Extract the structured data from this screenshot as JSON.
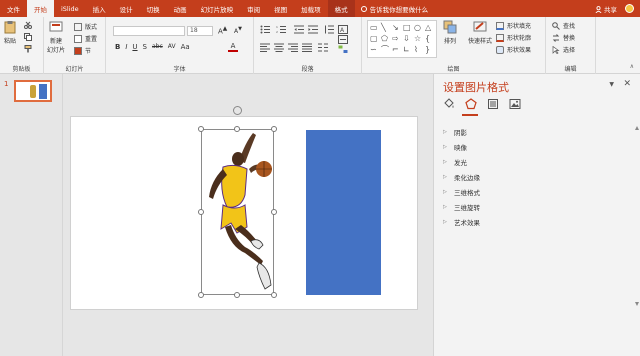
{
  "tabs": [
    "文件",
    "开始",
    "iSlide",
    "插入",
    "设计",
    "切换",
    "动画",
    "幻灯片放映",
    "审阅",
    "视图",
    "加载项",
    "格式"
  ],
  "active_tab": "开始",
  "tell_me": "告诉我你想要做什么",
  "share": "共享",
  "ribbon": {
    "clipboard": {
      "paste": "粘贴",
      "label": "剪贴板"
    },
    "slides": {
      "new_slide": "新建\n幻灯片",
      "layout": "版式",
      "reset": "重置",
      "section": "节",
      "label": "幻灯片"
    },
    "font": {
      "font_size": "18",
      "letters": [
        "B",
        "I",
        "U",
        "S",
        "abc",
        "AV",
        "Aa"
      ],
      "label": "字体"
    },
    "paragraph": {
      "label": "段落"
    },
    "drawing": {
      "arrange": "排列",
      "quick_styles": "快速样式",
      "fill": "形状填充",
      "outline": "形状轮廓",
      "effects": "形状效果",
      "label": "绘图"
    },
    "editing": {
      "find": "查找",
      "replace": "替换",
      "select": "选择",
      "label": "编辑"
    }
  },
  "thumbnail": {
    "slide_number": "1"
  },
  "format_pane": {
    "title": "设置图片格式",
    "sections": [
      "阴影",
      "映像",
      "发光",
      "柔化边缘",
      "三维格式",
      "三维旋转",
      "艺术效果"
    ]
  },
  "colors": {
    "accent": "#c43e1c",
    "shape_fill": "#4472c4"
  }
}
